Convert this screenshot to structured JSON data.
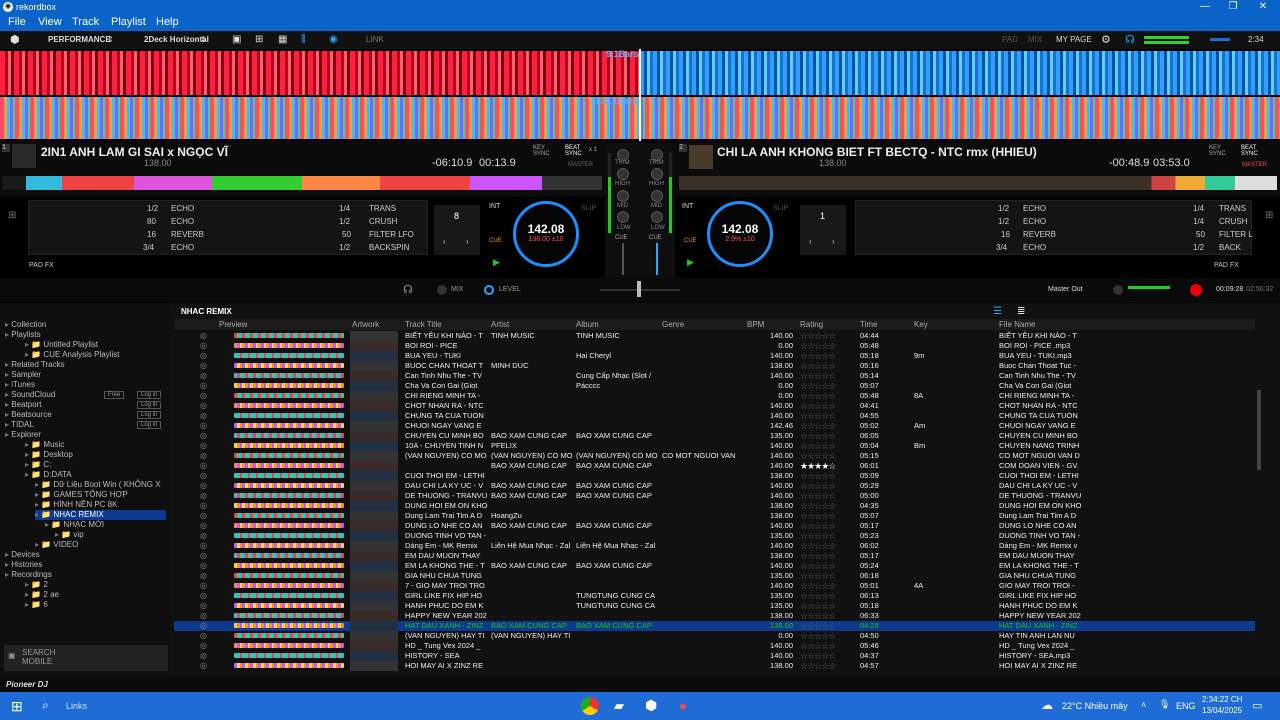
{
  "window": {
    "title": "rekordbox",
    "min": "—",
    "max": "❐",
    "close": "✕"
  },
  "menu": [
    "File",
    "View",
    "Track",
    "Playlist",
    "Help"
  ],
  "toolbar": {
    "mode": "PERFORMANCE",
    "layout": "2Deck Horizontal",
    "link": "LINK",
    "mypage": "MY PAGE",
    "clock": "2:34",
    "pad": "PAD",
    "mix": "MIX"
  },
  "waveform": {
    "bars_a": "9.1Bars",
    "bars_b": "135.1Bars"
  },
  "deck1": {
    "num": "1",
    "title": "2IN1 ANH LAM GI SAI x NGỌC VĨ",
    "bpm_base": "138.00",
    "remaining": "-06:10.9",
    "elapsed": "00:13.9",
    "keysync": "KEY SYNC",
    "beatsync": "BEAT SYNC",
    "master": "MASTER",
    "x1": "x 1",
    "bpm": "142.08",
    "pitch": "138.00 ±10",
    "int": "INT",
    "beatjump": "8",
    "slip": "SLIP",
    "cue": "CUE"
  },
  "deck2": {
    "num": "2",
    "title": "CHI LA ANH KHONG BIET FT BECTQ - NTC rmx (HHIEU)",
    "bpm_base": "138.00",
    "remaining": "-00:48.9",
    "elapsed": "03:53.0",
    "keysync": "KEY SYNC",
    "beatsync": "BEAT SYNC",
    "master": "MASTER",
    "bpm": "142.08",
    "pitch": "2.9% ±10",
    "int": "INT",
    "beatjump": "1",
    "slip": "SLIP",
    "cue": "CUE"
  },
  "fx_left": {
    "a": [
      {
        "v": "1/2",
        "n": "ECHO"
      },
      {
        "v": "80",
        "n": "ECHO"
      },
      {
        "v": "16",
        "n": "REVERB"
      },
      {
        "v": "3/4",
        "n": "ECHO"
      }
    ],
    "b": [
      {
        "v": "1/4",
        "n": "TRANS"
      },
      {
        "v": "1/2",
        "n": "CRUSH"
      },
      {
        "v": "50",
        "n": "FILTER LFO"
      },
      {
        "v": "1/2",
        "n": "BACKSPIN"
      }
    ],
    "padfx": "PAD FX"
  },
  "fx_right": {
    "a": [
      {
        "v": "1/2",
        "n": "ECHO"
      },
      {
        "v": "1/2",
        "n": "ECHO"
      },
      {
        "v": "16",
        "n": "REVERB"
      },
      {
        "v": "3/4",
        "n": "ECHO"
      }
    ],
    "b": [
      {
        "v": "1/4",
        "n": "TRANS"
      },
      {
        "v": "1/4",
        "n": "CRUSH"
      },
      {
        "v": "50",
        "n": "FILTER L"
      },
      {
        "v": "1/2",
        "n": "BACK"
      }
    ],
    "padfx": "PAD FX"
  },
  "mixer": {
    "trim": "TRIM",
    "high": "HIGH",
    "mid": "MID",
    "low": "LOW",
    "cue": "CUE"
  },
  "ctrl2": {
    "mix": "MIX",
    "level": "LEVEL",
    "master_out": "Master Out",
    "rec_time": "00:09:28",
    "rec_total": "02:50:32"
  },
  "browser": {
    "playlist_name": "NHAC REMIX",
    "search": "SEARCH",
    "mobile": "MOBILE"
  },
  "tree": [
    {
      "t": "Collection",
      "l": 0
    },
    {
      "t": "Playlists",
      "l": 0
    },
    {
      "t": "Untitled Playlist",
      "l": 2
    },
    {
      "t": "CUE Analysis Playlist",
      "l": 2
    },
    {
      "t": "Related Tracks",
      "l": 0
    },
    {
      "t": "Sampler",
      "l": 0
    },
    {
      "t": "iTunes",
      "l": 0
    },
    {
      "t": "SoundCloud",
      "l": 0
    },
    {
      "t": "Beatport",
      "l": 0
    },
    {
      "t": "Beatsource",
      "l": 0
    },
    {
      "t": "TIDAL",
      "l": 0
    },
    {
      "t": "Explorer",
      "l": 0
    },
    {
      "t": "Music",
      "l": 2
    },
    {
      "t": "Desktop",
      "l": 2
    },
    {
      "t": "C:",
      "l": 2
    },
    {
      "t": "D:DATA",
      "l": 2
    },
    {
      "t": "Dữ Liệu Boot Win ( KHÔNG X",
      "l": 3
    },
    {
      "t": "GAMES TỔNG HỢP",
      "l": 3
    },
    {
      "t": "HÌNH NỀN PC 8K",
      "l": 3
    },
    {
      "t": "NHAC REMIX",
      "l": 3,
      "sel": true
    },
    {
      "t": "NHẠC MỚI",
      "l": 4
    },
    {
      "t": "vip",
      "l": 5
    },
    {
      "t": "VIDEO",
      "l": 3
    },
    {
      "t": "Devices",
      "l": 0
    },
    {
      "t": "Histories",
      "l": 0
    },
    {
      "t": "Recordings",
      "l": 0
    },
    {
      "t": "2",
      "l": 2
    },
    {
      "t": "2 ae",
      "l": 2
    },
    {
      "t": "6",
      "l": 2
    }
  ],
  "tree_badges": {
    "free": "Free",
    "login": "Log in"
  },
  "columns": [
    "Preview",
    "Artwork",
    "Track Title",
    "Artist",
    "Album",
    "Genre",
    "BPM",
    "Rating",
    "Time",
    "Key",
    "File Name"
  ],
  "tracks": [
    [
      "BIẾT YÊU KHI NÀO - T",
      "TINH MUSIC",
      "TINH MUSIC",
      "",
      "140.00",
      "04:44",
      "",
      "BIẾT YÊU KHI NÀO - T"
    ],
    [
      "BOI ROI - PICE",
      "",
      "",
      "",
      "0.00",
      "05:48",
      "",
      "BOI ROI - PICE .mp3"
    ],
    [
      "BUA YEU - TUKI",
      "",
      "Hai Cheryl",
      "",
      "140.00",
      "05:18",
      "9m",
      "BUA YEU - TUKI.mp3"
    ],
    [
      "BUOC CHAN THOAT T",
      "MINH DUC",
      "",
      "",
      "138.00",
      "05:16",
      "",
      "Buoc Chan Thoat Tuc -"
    ],
    [
      "Can Tinh Nhu Thе - TV",
      "",
      "Cung Cấp Nhạc (Slot /",
      "",
      "140.00",
      "05:14",
      "",
      "Can Tinh Nhu The - TV"
    ],
    [
      "Cha Va Con Gai (Giot",
      "",
      "Pácccc",
      "",
      "0.00",
      "05:07",
      "",
      "Cha Va Con Gai (Giot"
    ],
    [
      "CHI RIENG MINH TA -",
      "",
      "",
      "",
      "0.00",
      "05:48",
      "8A",
      "CHI RIENG MINH TA -"
    ],
    [
      "CHOT NHAN RA - NTC",
      "",
      "",
      "",
      "140.00",
      "04:41",
      "",
      "CHOT NHAN RA - NTC"
    ],
    [
      "CHUNG TA CUA TUON",
      "",
      "",
      "",
      "140.00",
      "04:55",
      "",
      "CHUNG TA CUA TUON"
    ],
    [
      "CHUOI NGAY VANG E",
      "",
      "",
      "",
      "142.46",
      "05:02",
      "Am",
      "CHUOI NGAY VANG E"
    ],
    [
      "CHUYEN CU MINH BO",
      "BAO XAM CUNG CAP",
      "BAO XAM CUNG CAP",
      "",
      "135.00",
      "06:05",
      "",
      "CHUYEN CU MINH BO"
    ],
    [
      "10A - CHUYEN TINH N",
      "PFELIX",
      "",
      "",
      "140.00",
      "05:04",
      "Bm",
      "CHUYEN NANG TRINH"
    ],
    [
      "(VAN NGUYEN) CO MO",
      "(VAN NGUYEN) CO MO",
      "(VAN NGUYEN) CO MO",
      "CO MOT NGUOI VAN",
      "140.00",
      "05:15",
      "",
      "CO MOT NGUOI VAN D"
    ],
    [
      "",
      "BAO XAM CUNG CAP",
      "BAO XAM CUNG CAP",
      "",
      "140.00",
      "06:01",
      "",
      "COM DOAN VIEN - GV."
    ],
    [
      "CUOI THOI EM - LETHI",
      "",
      "",
      "",
      "138.00",
      "05:09",
      "",
      "CUOI THOI EM - LETHI"
    ],
    [
      "DAU CHI LA KY UC - V",
      "BAO XAM CUNG CAP",
      "BAO XAM CUNG CAP",
      "",
      "140.00",
      "05:29",
      "",
      "DAU CHI LA KY UC - V"
    ],
    [
      "DE THUONG - TRANVU",
      "BAO XAM CUNG CAP",
      "BAO XAM CUNG CAP",
      "",
      "140.00",
      "05:00",
      "",
      "DE THUONG - TRANVU"
    ],
    [
      "DUNG HOI EM ON KHO",
      "",
      "",
      "",
      "138.00",
      "04:35",
      "",
      "DUNG HOI EM ON KHO"
    ],
    [
      "Dung Lam Trai Tim A D",
      "HoangZu",
      "",
      "",
      "138.00",
      "05:07",
      "",
      "Dung Lam Trai Tim A D"
    ],
    [
      "DUNG LO NHE CO AN",
      "BAO XAM CUNG CAP",
      "BAO XAM CUNG CAP",
      "",
      "140.00",
      "05:17",
      "",
      "DUNG LO NHE CO AN"
    ],
    [
      "DUONG TINH VO TAN -",
      "",
      "",
      "",
      "135.00",
      "05:23",
      "",
      "DUONG TINH VO TAN -"
    ],
    [
      "Dáng Em - MK Remix",
      "Liên Hệ Mua Nhạc - Zal",
      "Liên Hệ Mua Nhạc - Zal",
      "",
      "140.00",
      "06:02",
      "",
      "Dáng Em - MK Remix v"
    ],
    [
      "EM DAU MUON THAY",
      "",
      "",
      "",
      "138.00",
      "05:17",
      "",
      "EM DAU MUON THAY"
    ],
    [
      "EM LA KHONG THE - T",
      "BAO XAM CUNG CAP",
      "BAO XAM CUNG CAP",
      "",
      "140.00",
      "05:24",
      "",
      "EM LA KHONG THE - T"
    ],
    [
      "GIA NHU CHUA TUNG",
      "",
      "",
      "",
      "135.00",
      "06:18",
      "",
      "GIA NHU CHUA TUNG"
    ],
    [
      "7 - GIO MAY TROI TRO",
      "",
      "",
      "",
      "140.00",
      "05:01",
      "4A",
      "GIO MAY TROI TROI -"
    ],
    [
      "GIRL LIKE FIX HIP HO",
      "",
      "TUNGTUNG CUNG CA",
      "",
      "135.00",
      "06:13",
      "",
      "GIRL LIKE FIX HIP HO"
    ],
    [
      "HANH PHUC DO EM K",
      "",
      "TUNGTUNG CUNG CA",
      "",
      "135.00",
      "05:18",
      "",
      "HANH PHUC DO EM K"
    ],
    [
      "HAPPY NEW YEAR 202",
      "",
      "",
      "",
      "138.00",
      "06:33",
      "",
      "HAPPY NEW YEAR 202"
    ],
    [
      "HAT DAU XANH - ZINZ",
      "BAO XAM CUNG CAP",
      "BAO XAM CUNG CAP",
      "",
      "138.00",
      "04:29",
      "",
      "HAT DAU XANH - ZINZ"
    ],
    [
      "(VAN NGUYEN) HAY TI",
      "(VAN NGUYEN) HAY TI",
      "",
      "",
      "0.00",
      "04:50",
      "",
      "HAY TIN ANH LAN NU"
    ],
    [
      "HD _ Tung Vex 2024 _",
      "",
      "",
      "",
      "140.00",
      "05:46",
      "",
      "HD _ Tung Vex 2024 _"
    ],
    [
      "HISTORY - SEA",
      "",
      "",
      "",
      "140.00",
      "04:37",
      "",
      "HISTORY - SEA.mp3"
    ],
    [
      "HOI MAY AI X ZINZ RE",
      "",
      "",
      "",
      "138.00",
      "04:57",
      "",
      "HOI MAY AI X ZINZ RE"
    ]
  ],
  "highlight_row": 29,
  "rated_row": 13,
  "footer": {
    "brand": "Pioneer DJ"
  },
  "taskbar": {
    "search": "Links",
    "weather": "22°C  Nhiều mây",
    "lang": "ENG",
    "time": "2:34:22 CH",
    "date": "13/04/2025"
  }
}
